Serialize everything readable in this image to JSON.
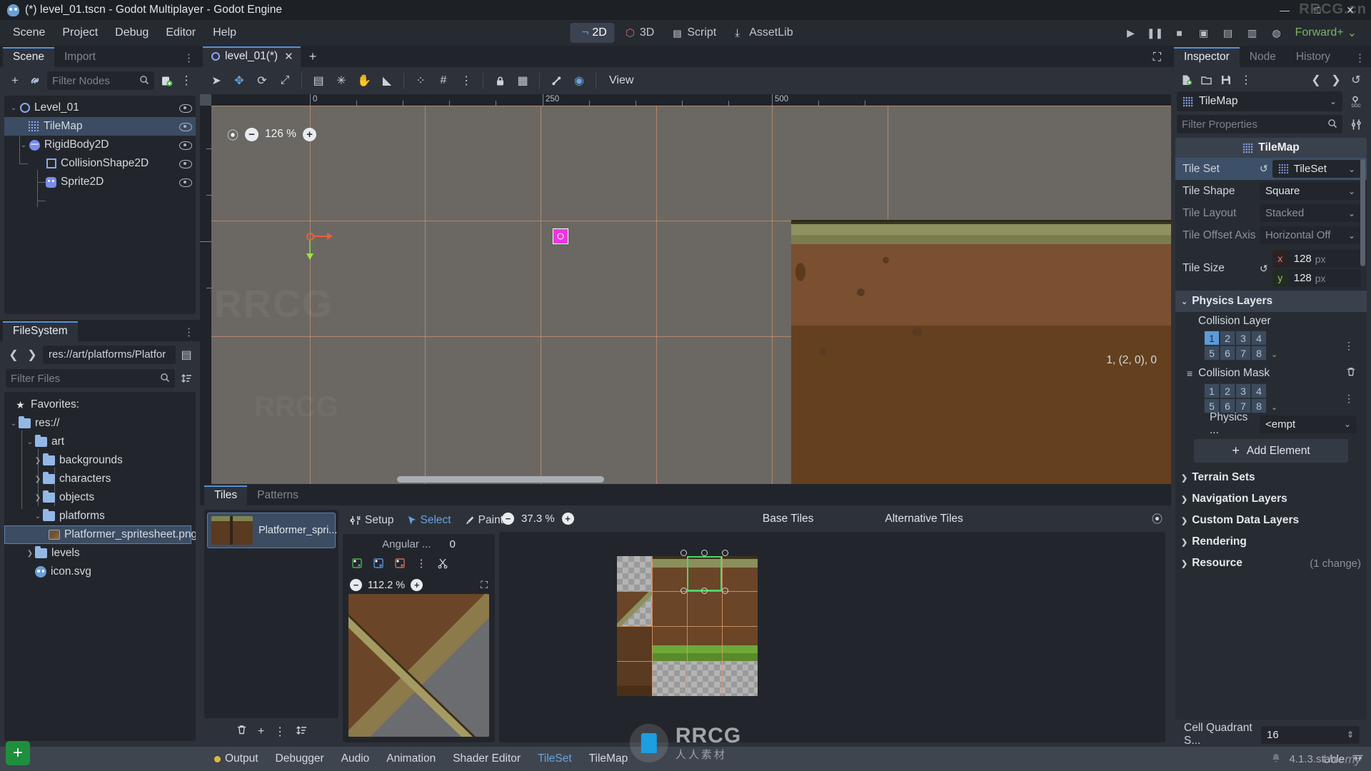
{
  "window": {
    "title": "(*) level_01.tscn - Godot Multiplayer - Godot Engine",
    "minimize": "—",
    "maximize": "□",
    "close": "✕"
  },
  "menubar": {
    "items": [
      "Scene",
      "Project",
      "Debug",
      "Editor",
      "Help"
    ],
    "modes": [
      {
        "label": "2D",
        "icon": "2d-icon",
        "active": true
      },
      {
        "label": "3D",
        "icon": "3d-icon",
        "active": false
      },
      {
        "label": "Script",
        "icon": "script-icon",
        "active": false
      },
      {
        "label": "AssetLib",
        "icon": "assetlib-icon",
        "active": false
      }
    ],
    "run_controls": [
      {
        "name": "play-button",
        "glyph": "▶"
      },
      {
        "name": "pause-button",
        "glyph": "❚❚"
      },
      {
        "name": "stop-button",
        "glyph": "■"
      },
      {
        "name": "play-scene-button",
        "glyph": "▣"
      },
      {
        "name": "play-custom-scene-button",
        "glyph": "▤"
      },
      {
        "name": "movie-writer-button",
        "glyph": "▥"
      },
      {
        "name": "remote-debug-button",
        "glyph": "◍"
      }
    ],
    "renderer": "Forward+",
    "renderer_chevron": "⌄"
  },
  "scene_dock": {
    "tabs": [
      {
        "label": "Scene",
        "active": true
      },
      {
        "label": "Import",
        "active": false
      }
    ],
    "tab_menu": "⋮",
    "toolbar": [
      {
        "name": "add-node-button",
        "glyph": "+"
      },
      {
        "name": "instance-scene-button",
        "glyph": "🔗"
      }
    ],
    "filter_placeholder": "Filter Nodes",
    "filter_value": "",
    "toolbar_right": [
      {
        "name": "attach-script-button",
        "glyph": "▤"
      },
      {
        "name": "scene-options-menu",
        "glyph": "⋮"
      }
    ],
    "nodes": [
      {
        "label": "Level_01",
        "icon": "node2d-icon",
        "depth": 0,
        "twisty": "⌄",
        "selected": false
      },
      {
        "label": "TileMap",
        "icon": "tilemap-icon",
        "depth": 1,
        "twisty": "",
        "selected": true
      },
      {
        "label": "RigidBody2D",
        "icon": "rigidbody-icon",
        "depth": 1,
        "twisty": "⌄",
        "selected": false
      },
      {
        "label": "CollisionShape2D",
        "icon": "collisionshape-icon",
        "depth": 2,
        "twisty": "",
        "selected": false
      },
      {
        "label": "Sprite2D",
        "icon": "sprite-icon",
        "depth": 2,
        "twisty": "",
        "selected": false
      }
    ]
  },
  "filesystem_dock": {
    "tabs": [
      {
        "label": "FileSystem",
        "active": true
      }
    ],
    "tab_menu": "⋮",
    "back_arrow": "❮",
    "forward_arrow": "❯",
    "path": "res://art/platforms/Platfor",
    "toggle_split_glyph": "▤",
    "filter_placeholder": "Filter Files",
    "filter_value": "",
    "search_glyph": "🔍",
    "sort_glyph": "⇅",
    "items": [
      {
        "label": "Favorites:",
        "icon": "star-icon",
        "depth": 0,
        "twisty": "",
        "type": "favorites"
      },
      {
        "label": "res://",
        "icon": "folder-icon",
        "depth": 0,
        "twisty": "⌄",
        "type": "folder"
      },
      {
        "label": "art",
        "icon": "folder-icon",
        "depth": 1,
        "twisty": "⌄",
        "type": "folder"
      },
      {
        "label": "backgrounds",
        "icon": "folder-icon",
        "depth": 2,
        "twisty": "❯",
        "type": "folder"
      },
      {
        "label": "characters",
        "icon": "folder-icon",
        "depth": 2,
        "twisty": "❯",
        "type": "folder"
      },
      {
        "label": "objects",
        "icon": "folder-icon",
        "depth": 2,
        "twisty": "❯",
        "type": "folder"
      },
      {
        "label": "platforms",
        "icon": "folder-icon",
        "depth": 2,
        "twisty": "⌄",
        "type": "folder"
      },
      {
        "label": "Platformer_spritesheet.png",
        "icon": "png-icon",
        "depth": 3,
        "twisty": "",
        "type": "file",
        "selected": true
      },
      {
        "label": "levels",
        "icon": "folder-icon",
        "depth": 1,
        "twisty": "❯",
        "type": "folder"
      },
      {
        "label": "icon.svg",
        "icon": "svg-icon",
        "depth": 1,
        "twisty": "",
        "type": "file"
      }
    ]
  },
  "scene_tabs": {
    "tabs": [
      {
        "label": "level_01(*)",
        "active": true,
        "close": "✕"
      }
    ],
    "add_tab": "+",
    "expand_glyph": "⛶"
  },
  "viewport_toolbar": {
    "tools": [
      {
        "name": "select-mode-tool",
        "glyph": "➤",
        "accent": false
      },
      {
        "name": "move-mode-tool",
        "glyph": "✥",
        "accent": true
      },
      {
        "name": "rotate-mode-tool",
        "glyph": "⟳",
        "accent": false
      },
      {
        "name": "scale-mode-tool",
        "glyph": "⤢",
        "accent": false
      },
      {
        "name": "list-selection-tool",
        "glyph": "▤",
        "accent": false
      },
      {
        "name": "ruler-snap-tool",
        "glyph": "✳",
        "accent": false
      },
      {
        "name": "pan-mode-tool",
        "glyph": "✋",
        "accent": false
      },
      {
        "name": "ruler-mode-tool",
        "glyph": "◣",
        "accent": false
      },
      {
        "name": "smart-snap-tool",
        "glyph": "⁘",
        "accent": false
      },
      {
        "name": "grid-snap-tool",
        "glyph": "#",
        "accent": false
      },
      {
        "name": "snap-options-menu",
        "glyph": "⋮",
        "accent": false
      },
      {
        "name": "lock-tool",
        "glyph": "🔒",
        "accent": false
      },
      {
        "name": "group-tool",
        "glyph": "▦",
        "accent": false
      },
      {
        "name": "skeleton-options-menu",
        "glyph": "🦴",
        "accent": false
      },
      {
        "name": "preview-canvas-scale-tool",
        "glyph": "◉",
        "accent": true
      }
    ],
    "view_label": "View"
  },
  "viewport": {
    "zoom": "126 %",
    "zoom_reset_glyph": "⦿",
    "zoom_out": "−",
    "zoom_in": "+",
    "ruler_labels": [
      "0",
      "250",
      "500"
    ]
  },
  "tileset_panel": {
    "tabs": [
      {
        "label": "Tiles",
        "active": true
      },
      {
        "label": "Patterns",
        "active": false
      }
    ],
    "source": {
      "name": "Platformer_spri...",
      "selected": true
    },
    "source_actions": [
      {
        "name": "delete-source-button",
        "glyph": "🗑"
      },
      {
        "name": "add-source-button",
        "glyph": "+"
      },
      {
        "name": "source-options-menu",
        "glyph": "⋮"
      },
      {
        "name": "sort-sources-button",
        "glyph": "⇅"
      }
    ],
    "tools": [
      {
        "label": "Setup",
        "icon": "setup-icon",
        "active": false
      },
      {
        "label": "Select",
        "icon": "cursor-icon",
        "active": true
      },
      {
        "label": "Paint",
        "icon": "brush-icon",
        "active": false
      }
    ],
    "angular_label": "Angular ...",
    "angular_value": "0",
    "angular_tools": [
      {
        "name": "tile-transform-1",
        "glyph": "⬓"
      },
      {
        "name": "tile-transform-2",
        "glyph": "⬔"
      },
      {
        "name": "tile-transform-3",
        "glyph": "⬕"
      },
      {
        "name": "tile-transform-menu",
        "glyph": "⋮"
      },
      {
        "name": "tile-flip-tool",
        "glyph": "✂"
      }
    ],
    "preview_zoom": "112.2 %",
    "preview_zoom_out": "−",
    "preview_zoom_in": "+",
    "preview_center_glyph": "⛶",
    "atlas_zoom": "37.3 %",
    "atlas_zoom_out": "−",
    "atlas_zoom_in": "+",
    "atlas_center_glyph": "⦿",
    "atlas_labels": {
      "base": "Base Tiles",
      "alternative": "Alternative Tiles"
    },
    "status": "1, (2, 0), 0"
  },
  "bottom_bar": {
    "tabs": [
      {
        "label": "Output",
        "active": false,
        "dot": true
      },
      {
        "label": "Debugger",
        "active": false,
        "dot": false
      },
      {
        "label": "Audio",
        "active": false,
        "dot": false
      },
      {
        "label": "Animation",
        "active": false,
        "dot": false
      },
      {
        "label": "Shader Editor",
        "active": false,
        "dot": false
      },
      {
        "label": "TileSet",
        "active": true,
        "dot": false
      },
      {
        "label": "TileMap",
        "active": false,
        "dot": false
      }
    ],
    "bell_glyph": "🔔",
    "version": "4.1.3.stable",
    "expand_glyph": "⇱⇲"
  },
  "inspector": {
    "tabs": [
      {
        "label": "Inspector",
        "active": true
      },
      {
        "label": "Node",
        "active": false
      },
      {
        "label": "History",
        "active": false
      }
    ],
    "tab_menu": "⋮",
    "toolbar": [
      {
        "name": "new-resource-button",
        "glyph": "🗋"
      },
      {
        "name": "open-resource-button",
        "glyph": "🗀"
      },
      {
        "name": "save-resource-button",
        "glyph": "🖫"
      },
      {
        "name": "resource-options-menu",
        "glyph": "⋮"
      }
    ],
    "nav": [
      {
        "name": "history-back-button",
        "glyph": "❮"
      },
      {
        "name": "history-forward-button",
        "glyph": "❯"
      },
      {
        "name": "history-menu-button",
        "glyph": "↺"
      }
    ],
    "object_name": "TileMap",
    "object_chevron": "⌄",
    "doc_glyph": "DOC",
    "filter_placeholder": "Filter Properties",
    "filter_value": "",
    "search_glyph": "🔍",
    "tools_glyph": "⚒",
    "header": "TileMap",
    "properties": [
      {
        "name": "Tile Set",
        "value": "TileSet",
        "type": "resource",
        "highlight": true,
        "revert": "↺",
        "chevron": "⌄",
        "dim": false
      },
      {
        "name": "Tile Shape",
        "value": "Square",
        "type": "enum",
        "chevron": "⌄",
        "dim": false
      },
      {
        "name": "Tile Layout",
        "value": "Stacked",
        "type": "enum",
        "chevron": "⌄",
        "dim": true
      },
      {
        "name": "Tile Offset Axis",
        "value": "Horizontal Off",
        "type": "enum",
        "chevron": "⌄",
        "dim": true
      }
    ],
    "tile_size": {
      "label": "Tile Size",
      "revert": "↺",
      "x_axis": "x",
      "x_value": "128",
      "x_unit": "px",
      "y_axis": "y",
      "y_value": "128",
      "y_unit": "px"
    },
    "physics_layers": {
      "title": "Physics Layers",
      "chevron": "⌄",
      "collision_layer": {
        "title": "Collision Layer",
        "cells": [
          "1",
          "2",
          "3",
          "4",
          "5",
          "6",
          "7",
          "8"
        ],
        "active": [
          true,
          false,
          false,
          false,
          false,
          false,
          false,
          false
        ],
        "expand": "⌄",
        "menu": "⋮"
      },
      "collision_mask": {
        "title": "Collision Mask",
        "drag_glyph": "≡",
        "trash_glyph": "🗑",
        "cells": [
          "1",
          "2",
          "3",
          "4",
          "5",
          "6",
          "7",
          "8"
        ],
        "active": [
          false,
          false,
          false,
          false,
          false,
          false,
          false,
          false
        ],
        "expand": "⌄",
        "menu": "⋮"
      },
      "physics_material": {
        "label": "Physics ...",
        "value": "<empt",
        "chevron": "⌄"
      },
      "add_element": {
        "label": "Add Element",
        "glyph": "+"
      }
    },
    "sections": [
      {
        "label": "Terrain Sets",
        "chevron": "❯",
        "note": ""
      },
      {
        "label": "Navigation Layers",
        "chevron": "❯",
        "note": ""
      },
      {
        "label": "Custom Data Layers",
        "chevron": "❯",
        "note": ""
      },
      {
        "label": "Rendering",
        "chevron": "❯",
        "note": ""
      },
      {
        "label": "Resource",
        "chevron": "❯",
        "note": "(1 change)"
      }
    ],
    "footer": {
      "label": "Cell Quadrant S...",
      "value": "16",
      "stepper": "⇕"
    }
  },
  "watermarks": {
    "top_right": "RRCG.cn",
    "center_title": "RRCG",
    "center_sub": "人人素材",
    "udemy": "Udemy",
    "faint_left": "RRCG",
    "faint_center": "RRCG"
  },
  "colors": {
    "accent": "#5a8fd6",
    "selection": "#3b4c63",
    "grid": "#e09b6e",
    "renderer": "#7eb36a",
    "green_select": "#4ad86a",
    "magenta": "#ef35e0"
  }
}
